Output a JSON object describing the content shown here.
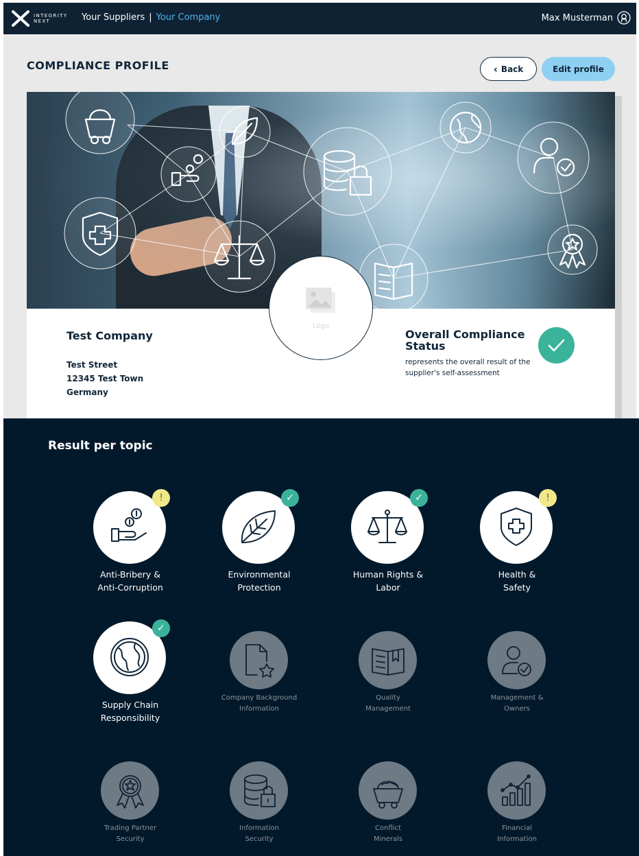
{
  "nav": {
    "logo_line1": "INTEGRITY",
    "logo_line2": "NEXT",
    "suppliers": "Your Suppliers",
    "separator": "|",
    "company": "Your Company",
    "user": "Max Musterman"
  },
  "header": {
    "title": "COMPLIANCE PROFILE",
    "back_label": "Back",
    "back_chevron": "‹",
    "edit_label": "Edit profile"
  },
  "company": {
    "name": "Test Company",
    "street": "Test Street",
    "city": "12345 Test Town",
    "country": "Germany",
    "logo_caption": "Logo"
  },
  "compliance": {
    "title_line1": "Overall Compliance",
    "title_line2": "Status",
    "description": "represents the overall result of the supplier's self-assessment",
    "status": "ok",
    "check_color": "#3bb39b"
  },
  "results": {
    "title": "Result per topic",
    "topics": [
      {
        "line1": "Anti-Bribery &",
        "line2": "Anti-Corruption",
        "status": "warning",
        "badge": "!",
        "icon": "hand-coins-icon",
        "active": true
      },
      {
        "line1": "Environmental",
        "line2": "Protection",
        "status": "ok",
        "badge": "✓",
        "icon": "leaf-icon",
        "active": true
      },
      {
        "line1": "Human Rights &",
        "line2": "Labor",
        "status": "ok",
        "badge": "✓",
        "icon": "scales-icon",
        "active": true
      },
      {
        "line1": "Health &",
        "line2": "Safety",
        "status": "warning",
        "badge": "!",
        "icon": "shield-cross-icon",
        "active": true
      },
      {
        "line1": "Supply Chain",
        "line2": "Responsibility",
        "status": "ok",
        "badge": "✓",
        "icon": "globe-icon",
        "active": true
      },
      {
        "line1": "Company Background",
        "line2": "Information",
        "icon": "document-star-icon",
        "active": false
      },
      {
        "line1": "Quality",
        "line2": "Management",
        "icon": "open-book-icon",
        "active": false
      },
      {
        "line1": "Management &",
        "line2": "Owners",
        "icon": "person-check-icon",
        "active": false
      },
      {
        "line1": "Trading Partner",
        "line2": "Security",
        "icon": "award-ribbon-icon",
        "active": false
      },
      {
        "line1": "Information",
        "line2": "Security",
        "icon": "database-lock-icon",
        "active": false
      },
      {
        "line1": "Conflict",
        "line2": "Minerals",
        "icon": "mine-cart-icon",
        "active": false
      },
      {
        "line1": "Financial",
        "line2": "Information",
        "icon": "bar-chart-icon",
        "active": false
      }
    ]
  },
  "colors": {
    "navy": "#0f2234",
    "dark_bg": "#02192b",
    "accent_blue": "#4fb3e8",
    "edit_button": "#8fd0f2",
    "ok_green": "#3bb39b",
    "warning_yellow": "#f1e88a",
    "inactive_gray": "#6e7a84"
  }
}
